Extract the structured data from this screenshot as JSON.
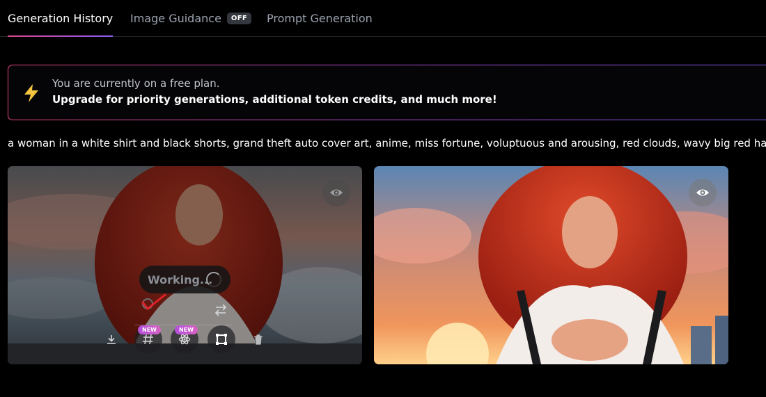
{
  "tabs": [
    {
      "label": "Generation History",
      "active": true
    },
    {
      "label": "Image Guidance",
      "badge": "OFF"
    },
    {
      "label": "Prompt Generation"
    }
  ],
  "banner": {
    "line1": "You are currently on a free plan.",
    "line2": "Upgrade for priority generations, additional token credits, and much more!",
    "icon": "lightning-bolt-icon"
  },
  "prompt": "a woman in a white shirt and black shorts, grand theft auto cover art, anime, miss fortune, voluptuous and arousing, red clouds, wavy big red hair,top gu",
  "cards": [
    {
      "status": "Working...",
      "tools": {
        "download": "download-icon",
        "upscale_badge": "NEW",
        "alchemy_badge": "NEW",
        "crop": "crop-icon",
        "delete": "trash-icon"
      }
    },
    {}
  ],
  "colors": {
    "accent_pink": "#d9468b",
    "accent_purple": "#8b5cf6",
    "bolt": "#f5c542",
    "check_red": "#e0212b"
  }
}
